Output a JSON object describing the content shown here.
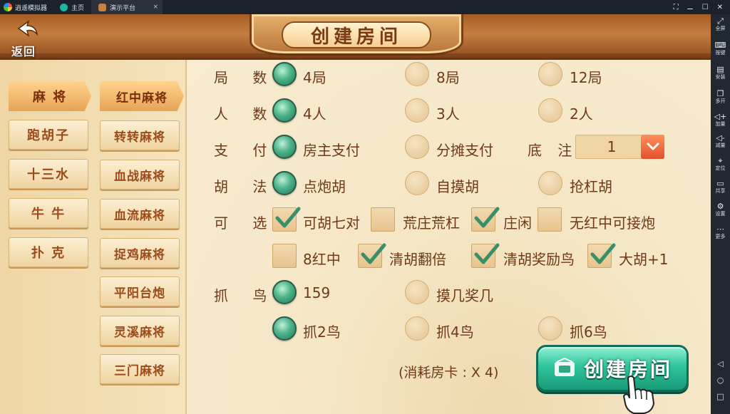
{
  "emulator": {
    "app_title": "逍遥模拟器",
    "tabs": [
      {
        "label": "主页"
      },
      {
        "label": "演示平台",
        "close": "×"
      }
    ],
    "window_controls": [
      "⛶",
      "⚊",
      "☐",
      "✕"
    ],
    "tools": [
      {
        "icon": "fullscreen-icon",
        "label": "全屏"
      },
      {
        "icon": "keyboard-icon",
        "label": "按键"
      },
      {
        "icon": "apk-install-icon",
        "label": "安装"
      },
      {
        "icon": "multi-open-icon",
        "label": "多开"
      },
      {
        "icon": "volume-up-icon",
        "label": "加量"
      },
      {
        "icon": "volume-down-icon",
        "label": "减量"
      },
      {
        "icon": "location-icon",
        "label": "定位"
      },
      {
        "icon": "share-folder-icon",
        "label": "共享"
      },
      {
        "icon": "settings-icon",
        "label": "设置"
      },
      {
        "icon": "more-icon",
        "label": "更多"
      }
    ],
    "nav": [
      "◁",
      "○",
      "□"
    ]
  },
  "header": {
    "back_label": "返回",
    "title": "创建房间"
  },
  "categories": [
    {
      "label": "麻 将",
      "active": true
    },
    {
      "label": "跑胡子",
      "active": false
    },
    {
      "label": "十三水",
      "active": false
    },
    {
      "label": "牛 牛",
      "active": false
    },
    {
      "label": "扑 克",
      "active": false
    }
  ],
  "subgames": [
    {
      "label": "红中麻将",
      "active": true
    },
    {
      "label": "转转麻将",
      "active": false
    },
    {
      "label": "血战麻将",
      "active": false
    },
    {
      "label": "血流麻将",
      "active": false
    },
    {
      "label": "捉鸡麻将",
      "active": false
    },
    {
      "label": "平阳台炮",
      "active": false
    },
    {
      "label": "灵溪麻将",
      "active": false
    },
    {
      "label": "三门麻将",
      "active": false
    }
  ],
  "rows": {
    "rounds": {
      "label": "局 数:",
      "options": [
        {
          "text": "4局",
          "selected": true
        },
        {
          "text": "8局",
          "selected": false
        },
        {
          "text": "12局",
          "selected": false
        }
      ]
    },
    "players": {
      "label": "人 数:",
      "options": [
        {
          "text": "4人",
          "selected": true
        },
        {
          "text": "3人",
          "selected": false
        },
        {
          "text": "2人",
          "selected": false
        }
      ]
    },
    "payment": {
      "label": "支 付:",
      "options": [
        {
          "text": "房主支付",
          "selected": true
        },
        {
          "text": "分摊支付",
          "selected": false
        }
      ]
    },
    "bet": {
      "label": "底 注:",
      "value": "1"
    },
    "hu_rule": {
      "label": "胡 法:",
      "options": [
        {
          "text": "点炮胡",
          "selected": true
        },
        {
          "text": "自摸胡",
          "selected": false
        },
        {
          "text": "抢杠胡",
          "selected": false
        }
      ]
    },
    "optional": {
      "label": "可 选:",
      "options": [
        {
          "text": "可胡七对",
          "checked": true
        },
        {
          "text": "荒庄荒杠",
          "checked": false
        },
        {
          "text": "庄闲",
          "checked": true
        },
        {
          "text": "无红中可接炮",
          "checked": false
        },
        {
          "text": "8红中",
          "checked": false
        },
        {
          "text": "清胡翻倍",
          "checked": true
        },
        {
          "text": "清胡奖励鸟",
          "checked": true
        },
        {
          "text": "大胡+1",
          "checked": true
        }
      ]
    },
    "birds": {
      "label": "抓 鸟:",
      "options": [
        {
          "text": "159",
          "selected": false
        },
        {
          "text": "摸几奖几",
          "selected": false
        },
        {
          "text": "抓2鸟",
          "selected": true
        },
        {
          "text": "抓4鸟",
          "selected": false
        },
        {
          "text": "抓6鸟",
          "selected": false
        }
      ]
    }
  },
  "footer": {
    "cost_text": "(消耗房卡 : X 4)",
    "create_label": "创建房间"
  },
  "colors": {
    "accent_green": "#2fc49b",
    "selected_radio": "#4cb38a",
    "text_brown": "#6e3a17",
    "header_brown": "#a45c25"
  }
}
